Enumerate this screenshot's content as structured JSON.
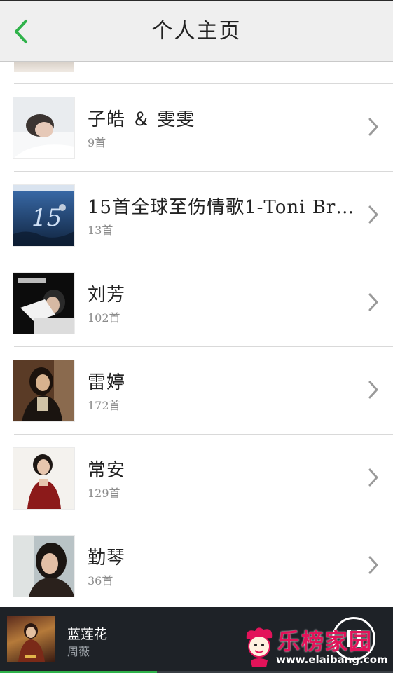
{
  "header": {
    "title": "个人主页",
    "accent_color": "#2fb24a"
  },
  "artists": [
    {
      "name": "子皓 ＆ 雯雯",
      "count": "9首"
    },
    {
      "name": "15首全球至伤情歌1-Toni Br…",
      "count": "13首"
    },
    {
      "name": "刘芳",
      "count": "102首"
    },
    {
      "name": "雷婷",
      "count": "172首"
    },
    {
      "name": "常安",
      "count": "129首"
    },
    {
      "name": "勤琴",
      "count": "36首"
    }
  ],
  "player": {
    "song_title": "蓝莲花",
    "song_artist": "周薇",
    "state_icon": "pause-icon",
    "progress_percent": 40
  },
  "watermark": {
    "text": "乐榜家园",
    "url": "www.elaibang.com"
  }
}
